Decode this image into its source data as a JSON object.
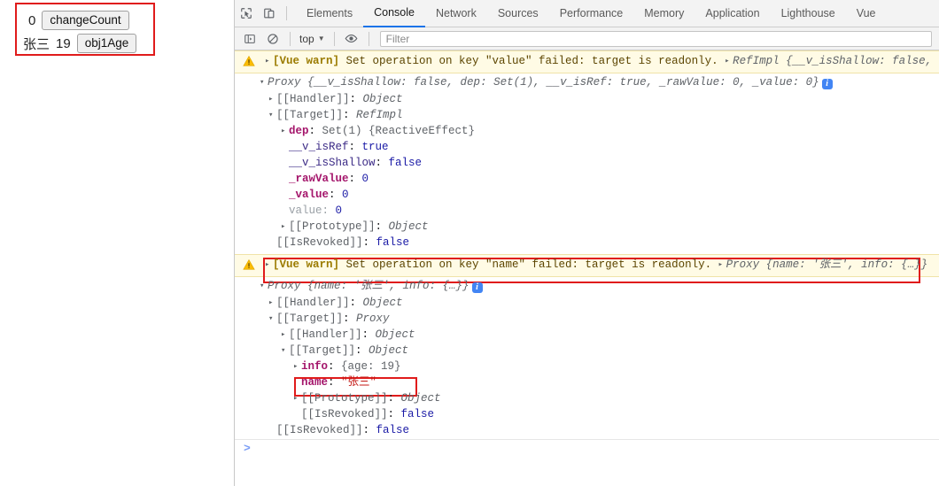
{
  "app_panel": {
    "line1": {
      "value": "0",
      "button": "changeCount"
    },
    "line2": {
      "name": "张三",
      "age": "19",
      "button": "obj1Age"
    }
  },
  "devtools": {
    "toolbar_icons": {
      "inspect": "inspect-element-icon",
      "device": "device-toolbar-icon",
      "sidebar": "console-sidebar-icon",
      "clear": "clear-console-icon",
      "eye": "live-expression-icon"
    },
    "tabs": [
      {
        "label": "Elements",
        "active": false
      },
      {
        "label": "Console",
        "active": true
      },
      {
        "label": "Network",
        "active": false
      },
      {
        "label": "Sources",
        "active": false
      },
      {
        "label": "Performance",
        "active": false
      },
      {
        "label": "Memory",
        "active": false
      },
      {
        "label": "Application",
        "active": false
      },
      {
        "label": "Lighthouse",
        "active": false
      },
      {
        "label": "Vue",
        "active": false
      }
    ],
    "context_selector": "top",
    "filter_placeholder": "Filter",
    "prompt_caret": ">"
  },
  "console": {
    "message1": {
      "warn_tag": "[Vue warn]",
      "warn_rest": " Set operation on key \"value\" failed: target is readonly.",
      "preview_class": "RefImpl",
      "preview_body": "{__v_isShallow: false, dep:",
      "proxy_label": "Proxy",
      "proxy_preview": "{__v_isShallow: false, dep: Set(1), __v_isRef: true, _rawValue: 0, _value: 0}",
      "rows": [
        {
          "indent": 1,
          "arrow": "closed",
          "key": "[[Handler]]",
          "keytype": "internal",
          "sep": ": ",
          "value": "Object",
          "valtype": "class"
        },
        {
          "indent": 1,
          "arrow": "open",
          "key": "[[Target]]",
          "keytype": "internal",
          "sep": ": ",
          "value": "RefImpl",
          "valtype": "class"
        },
        {
          "indent": 2,
          "arrow": "closed",
          "key": "dep",
          "keytype": "own",
          "sep": ": ",
          "value": "Set(1) {ReactiveEffect}",
          "valtype": "gray"
        },
        {
          "indent": 2,
          "arrow": "none",
          "key": "__v_isRef",
          "keytype": "plain",
          "sep": ": ",
          "value": "true",
          "valtype": "bool"
        },
        {
          "indent": 2,
          "arrow": "none",
          "key": "__v_isShallow",
          "keytype": "plain",
          "sep": ": ",
          "value": "false",
          "valtype": "bool"
        },
        {
          "indent": 2,
          "arrow": "none",
          "key": "_rawValue",
          "keytype": "own",
          "sep": ": ",
          "value": "0",
          "valtype": "num"
        },
        {
          "indent": 2,
          "arrow": "none",
          "key": "_value",
          "keytype": "own",
          "sep": ": ",
          "value": "0",
          "valtype": "num"
        },
        {
          "indent": 2,
          "arrow": "none",
          "key": "value",
          "keytype": "dim",
          "sep": ": ",
          "value": "0",
          "valtype": "num"
        },
        {
          "indent": 2,
          "arrow": "closed",
          "key": "[[Prototype]]",
          "keytype": "internal",
          "sep": ": ",
          "value": "Object",
          "valtype": "class"
        },
        {
          "indent": 1,
          "arrow": "none",
          "key": "[[IsRevoked]]",
          "keytype": "internal",
          "sep": ": ",
          "value": "false",
          "valtype": "bool"
        }
      ]
    },
    "message2": {
      "warn_tag": "[Vue warn]",
      "warn_rest": " Set operation on key \"name\" failed: target is readonly.",
      "preview_class": "Proxy",
      "preview_body": "{name: '张三', info: {…}}",
      "proxy_label": "Proxy",
      "proxy_preview": "{name: '张三', info: {…}}",
      "rows": [
        {
          "indent": 1,
          "arrow": "closed",
          "key": "[[Handler]]",
          "keytype": "internal",
          "sep": ": ",
          "value": "Object",
          "valtype": "class"
        },
        {
          "indent": 1,
          "arrow": "open",
          "key": "[[Target]]",
          "keytype": "internal",
          "sep": ": ",
          "value": "Proxy",
          "valtype": "class"
        },
        {
          "indent": 2,
          "arrow": "closed",
          "key": "[[Handler]]",
          "keytype": "internal",
          "sep": ": ",
          "value": "Object",
          "valtype": "class"
        },
        {
          "indent": 2,
          "arrow": "open",
          "key": "[[Target]]",
          "keytype": "internal",
          "sep": ": ",
          "value": "Object",
          "valtype": "class"
        },
        {
          "indent": 3,
          "arrow": "closed",
          "key": "info",
          "keytype": "own",
          "sep": ": ",
          "value": "{age: 19}",
          "valtype": "objpreview",
          "highlight": true
        },
        {
          "indent": 3,
          "arrow": "none",
          "key": "name",
          "keytype": "own",
          "sep": ": ",
          "value": "\"张三\"",
          "valtype": "str"
        },
        {
          "indent": 3,
          "arrow": "closed",
          "key": "[[Prototype]]",
          "keytype": "internal",
          "sep": ": ",
          "value": "Object",
          "valtype": "class"
        },
        {
          "indent": 3,
          "arrow": "none",
          "key": "[[IsRevoked]]",
          "keytype": "internal",
          "sep": ": ",
          "value": "false",
          "valtype": "bool"
        },
        {
          "indent": 1,
          "arrow": "none",
          "key": "[[IsRevoked]]",
          "keytype": "internal",
          "sep": ": ",
          "value": "false",
          "valtype": "bool"
        }
      ]
    }
  },
  "annotations": {
    "app_box_color": "#e01b1b",
    "warn2_box_color": "#c0392b",
    "info_box_color": "#e01b1b"
  }
}
